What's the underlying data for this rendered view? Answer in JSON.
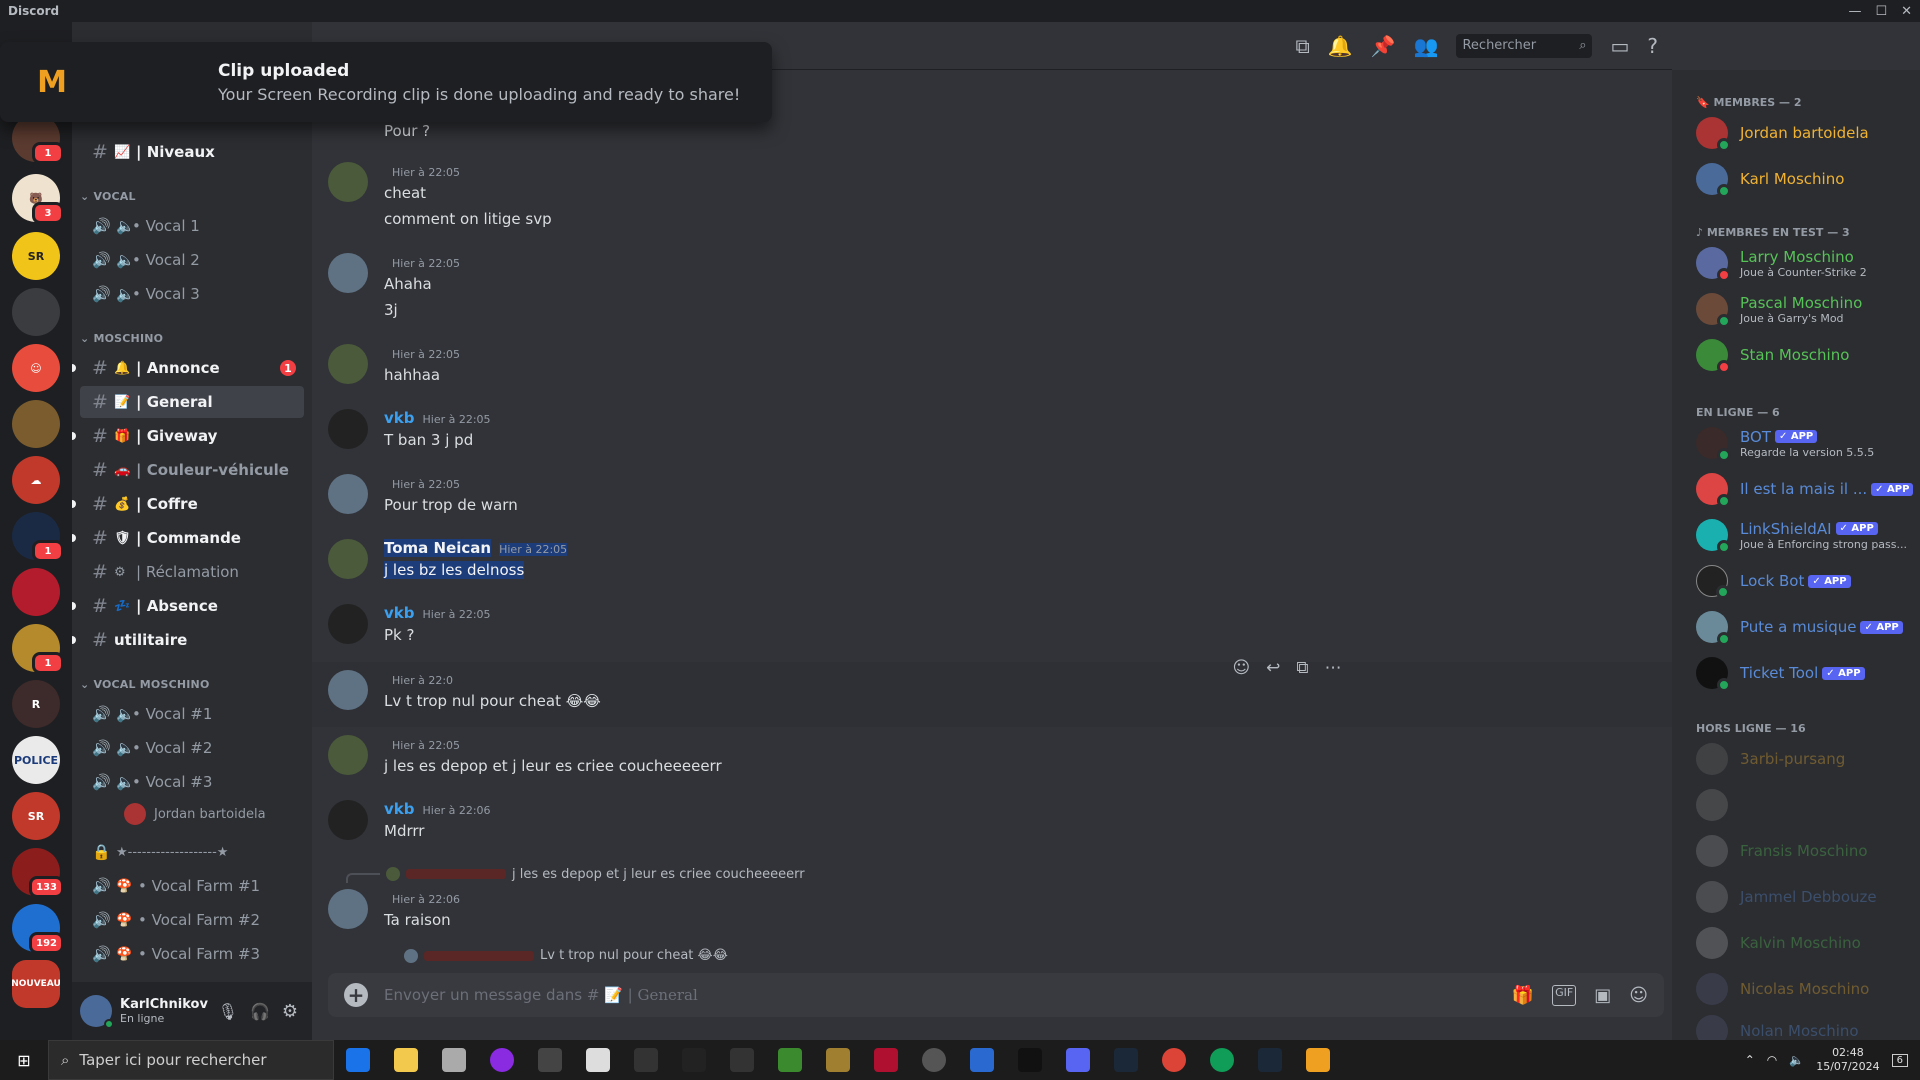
{
  "window": {
    "title": "Discord"
  },
  "toast": {
    "title": "Clip uploaded",
    "subtitle": "Your Screen Recording clip is done uploading and ready to share!"
  },
  "servers": {
    "badges": [
      "1",
      "3",
      "1",
      "1",
      "133",
      "192"
    ],
    "new_label": "NOUVEAU"
  },
  "channels": {
    "top_channel": "| Niveaux",
    "cat_vocal": "VOCAL",
    "vocal": [
      "• Vocal 1",
      "• Vocal 2",
      "• Vocal 3"
    ],
    "cat_moschino": "MOSCHINO",
    "moschino": [
      {
        "emoji": "🔔",
        "label": "| Annonce",
        "badge": "1"
      },
      {
        "emoji": "📝",
        "label": "| General"
      },
      {
        "emoji": "🎁",
        "label": "| Giveway"
      },
      {
        "emoji": "🚗",
        "label": "| Couleur-véhicule"
      },
      {
        "emoji": "💰",
        "label": "| Coffre"
      },
      {
        "emoji": "🛡",
        "label": "| Commande"
      },
      {
        "emoji": "⚙",
        "label": "| Réclamation"
      },
      {
        "emoji": "💤",
        "label": "| Absence"
      },
      {
        "emoji": "",
        "label": "utilitaire"
      }
    ],
    "cat_vocal_moschino": "VOCAL MOSCHINO",
    "vocal_moschino": [
      "• Vocal #1",
      "• Vocal #2",
      "• Vocal #3"
    ],
    "voice_user": "Jordan bartoidela",
    "locked": "★-------------------★",
    "farm": [
      "• Vocal Farm #1",
      "• Vocal Farm #2",
      "• Vocal Farm #3"
    ]
  },
  "user": {
    "name": "KarlChnikov",
    "status": "En ligne"
  },
  "header": {
    "search_placeholder": "Rechercher"
  },
  "messages": [
    {
      "line1": "Pour ?"
    },
    {
      "time": "Hier à 22:05",
      "line1": "cheat",
      "line2": "comment on litige svp"
    },
    {
      "time": "Hier à 22:05",
      "line1": "Ahaha",
      "line2": "3j"
    },
    {
      "time": "Hier à 22:05",
      "line1": "hahhaa"
    },
    {
      "author": "vkb",
      "time": "Hier à 22:05",
      "line1": "T ban 3 j pd"
    },
    {
      "time": "Hier à 22:05",
      "line1": "Pour trop de warn"
    },
    {
      "author": "Toma Neican",
      "time": "Hier à 22:05",
      "line1": "j les bz les delnoss"
    },
    {
      "author": "vkb",
      "time": "Hier à 22:05",
      "line1": "Pk ?"
    },
    {
      "time": "Hier à 22:0",
      "line1": "Lv t trop nul pour cheat 😂😂"
    },
    {
      "time": "Hier à 22:05",
      "line1": "j les es depop et j leur es criee coucheeeeerr"
    },
    {
      "author": "vkb",
      "time": "Hier à 22:06",
      "line1": "Mdrrr"
    },
    {
      "reply": "j les es depop et j leur es criee coucheeeeerr",
      "time": "Hier à 22:06",
      "line1": "Ta raison"
    },
    {
      "reply": "Lv t trop nul pour cheat 😂😂"
    }
  ],
  "composer": {
    "placeholder": "Envoyer un message dans #",
    "channel": "| General"
  },
  "members": {
    "cat1": "MEMBRES — 2",
    "group1": [
      {
        "name": "Jordan bartoidela"
      },
      {
        "name": "Karl Moschino"
      }
    ],
    "cat2": "MEMBRES EN TEST — 3",
    "group2": [
      {
        "name": "Larry Moschino",
        "sub": "Joue à Counter-Strike 2"
      },
      {
        "name": "Pascal Moschino",
        "sub": "Joue à Garry's Mod"
      },
      {
        "name": "Stan Moschino"
      }
    ],
    "cat3": "EN LIGNE — 6",
    "group3": [
      {
        "name": "BOT",
        "sub": "Regarde la version 5.5.5"
      },
      {
        "name": "Il est la mais il ..."
      },
      {
        "name": "LinkShieldAI",
        "sub": "Joue à Enforcing strong pass..."
      },
      {
        "name": "Lock Bot"
      },
      {
        "name": "Pute a musique"
      },
      {
        "name": "Ticket Tool"
      }
    ],
    "app_tag": "✓ APP",
    "cat4": "HORS LIGNE — 16",
    "group4": [
      "3arbi-pursang",
      "",
      "Fransis Moschino",
      "Jammel Debbouze",
      "Kalvin Moschino",
      "Nicolas Moschino",
      "Nolan Moschino"
    ]
  },
  "taskbar": {
    "search": "Taper ici pour rechercher",
    "time": "02:48",
    "date": "15/07/2024",
    "notif": "6"
  },
  "colors": {
    "red_name": "#c0392b",
    "vkb": "#3ba0f0",
    "gold": "#f0b232",
    "green": "#57c257",
    "link": "#5a8bd8"
  }
}
